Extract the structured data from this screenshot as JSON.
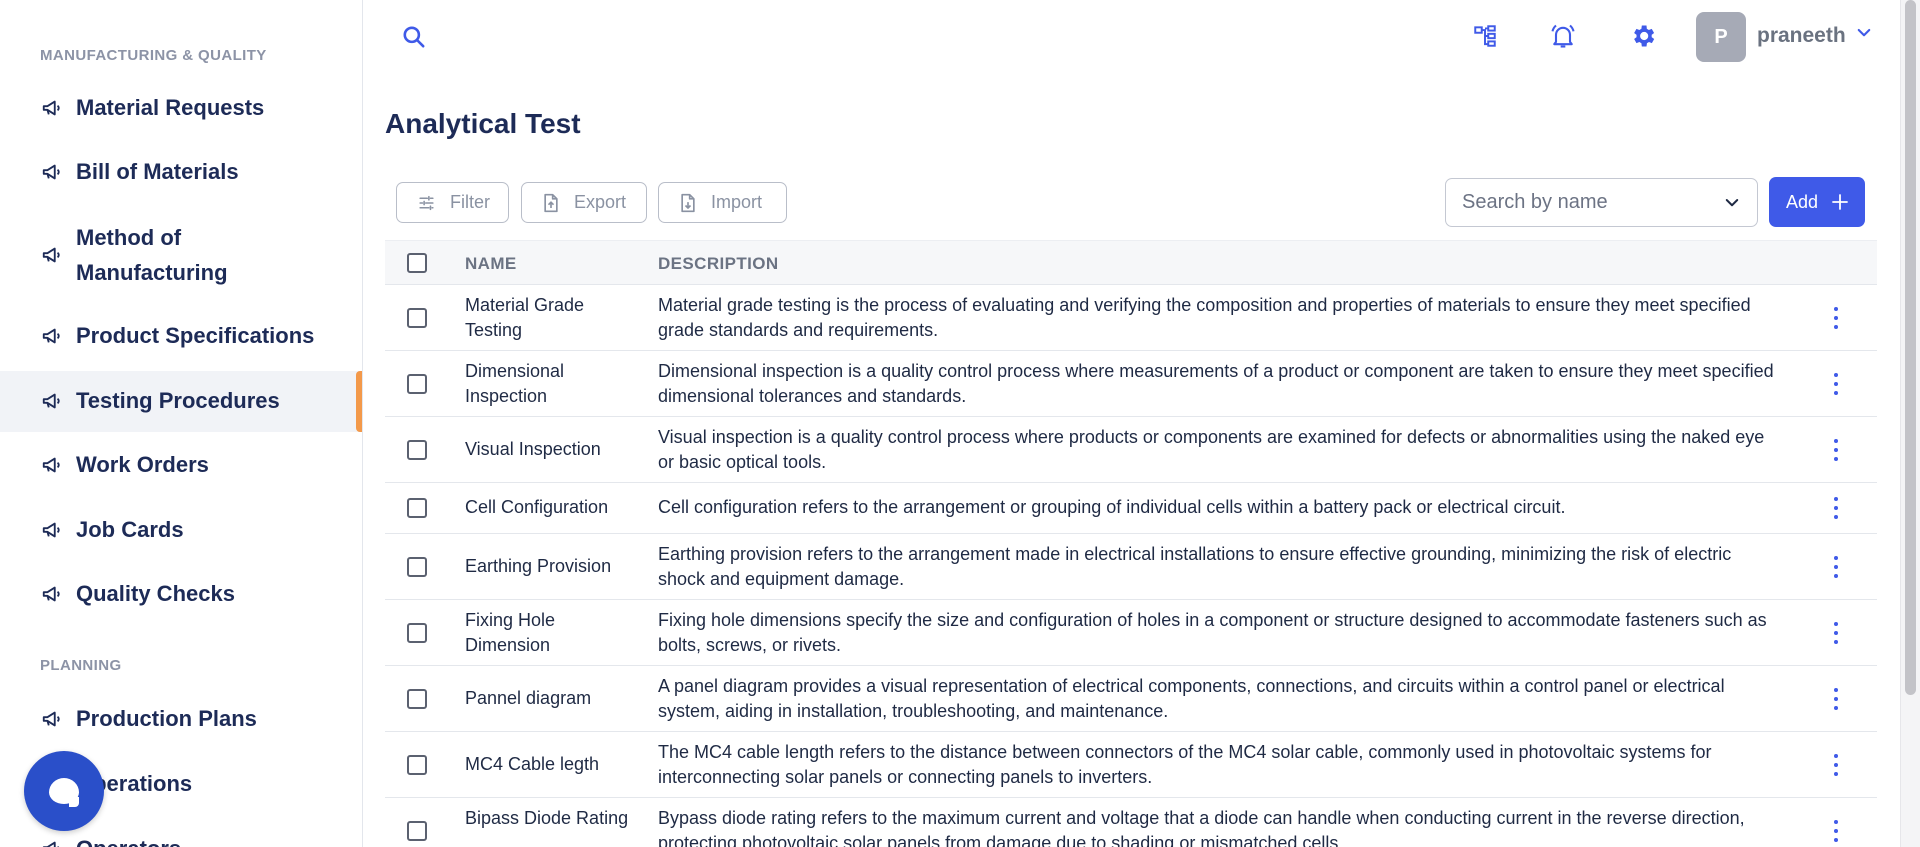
{
  "sidebar": {
    "section_manufacturing": "MANUFACTURING & QUALITY",
    "section_planning": "PLANNING",
    "items": [
      {
        "label": "Material Requests"
      },
      {
        "label": "Bill of Materials"
      },
      {
        "label": "Method of Manufacturing"
      },
      {
        "label": "Product Specifications"
      },
      {
        "label": "Testing Procedures"
      },
      {
        "label": "Work Orders"
      },
      {
        "label": "Job Cards"
      },
      {
        "label": "Quality Checks"
      },
      {
        "label": "Production Plans"
      },
      {
        "label": "Operations"
      },
      {
        "label": "Operators"
      }
    ],
    "active_item": "Testing Procedures"
  },
  "topbar": {
    "user_initial": "P",
    "username": "praneeth"
  },
  "page": {
    "title": "Analytical Test"
  },
  "toolbar": {
    "filter_label": "Filter",
    "export_label": "Export",
    "import_label": "Import",
    "search_placeholder": "Search by name",
    "add_label": "Add"
  },
  "table": {
    "columns": [
      "NAME",
      "DESCRIPTION"
    ],
    "rows": [
      {
        "name": "Material Grade Testing",
        "description": "Material grade testing is the process of evaluating and verifying the composition and properties of materials to ensure they meet specified grade standards and requirements."
      },
      {
        "name": "Dimensional Inspection",
        "description": "Dimensional inspection is a quality control process where measurements of a product or component are taken to ensure they meet specified dimensional tolerances and standards."
      },
      {
        "name": "Visual Inspection",
        "description": "Visual inspection is a quality control process where products or components are examined for defects or abnormalities using the naked eye or basic optical tools."
      },
      {
        "name": "Cell Configuration",
        "description": "Cell configuration refers to the arrangement or grouping of individual cells within a battery pack or electrical circuit."
      },
      {
        "name": "Earthing Provision",
        "description": "Earthing provision refers to the arrangement made in electrical installations to ensure effective grounding, minimizing the risk of electric shock and equipment damage."
      },
      {
        "name": "Fixing Hole Dimension",
        "description": "Fixing hole dimensions specify the size and configuration of holes in a component or structure designed to accommodate fasteners such as bolts, screws, or rivets."
      },
      {
        "name": "Pannel diagram",
        "description": "A panel diagram provides a visual representation of electrical components, connections, and circuits within a control panel or electrical system, aiding in installation, troubleshooting, and maintenance."
      },
      {
        "name": "MC4 Cable legth",
        "description": "The MC4 cable length refers to the distance between connectors of the MC4 solar cable, commonly used in photovoltaic systems for interconnecting solar panels or connecting panels to inverters."
      },
      {
        "name": "Bipass Diode Rating",
        "description": "Bypass diode rating refers to the maximum current and voltage that a diode can handle when conducting current in the reverse direction, protecting photovoltaic solar panels from damage due to shading or mismatched cells."
      }
    ]
  },
  "colors": {
    "accent": "#3f5ae8",
    "active_indicator": "#f3994a",
    "nav_text": "#1d2b57",
    "chat_bubble": "#2a4fc9"
  }
}
